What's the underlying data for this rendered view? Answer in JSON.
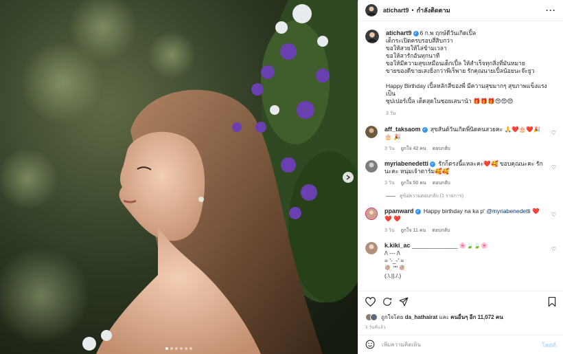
{
  "photo": {
    "carousel_dot_count": 6,
    "carousel_active_index": 0
  },
  "header": {
    "username": "atichart9",
    "separator": "•",
    "follow_state": "กำลังติดตาม"
  },
  "caption": {
    "username": "atichart9",
    "lines": [
      "6 ก.พ ฤกษ์ดีวันเกิดเปิ้ล",
      "เด็กระเปิดครบรอบสี่สิบกว่า",
      "ขอให้สวยให้ไล่ข้ามเวลา",
      "ขอให้สารักอันทุกนาที",
      "ขอให้มีความสุขเหมือนเด็กเปิ้ล ให้สำเร็จทุกสิ่งที่มันหมาย",
      "ขายของดีขายเสงยิ่งกว่าพีเร็พาย รักคุณนายเปิ้ลน้อยนะจ๊ะยูว",
      "",
      "Happy Birthday เปิ้ลหลักสี่ของพี่ มีความสุขมากๆ สุขภาพแข็งแรงเป็น",
      "ซุปเปอร์เปิ้ล เด็ดสุดในซอยเสนาน้า 🎁🎁🎁😍😍😍"
    ],
    "time": "3 วัน"
  },
  "comments": [
    {
      "username": "aff_taksaom",
      "verified": true,
      "text": "สุขสันต์วันเกิดพี่นิดคนสวยคะ 🙏❤️🎂❤️🎉🎂 🎉",
      "time": "3 วัน",
      "likes": "ถูกใจ 42 คน",
      "reply": "ตอบกลับ",
      "avatar_color": "#6b5a3e"
    },
    {
      "username": "myriabenedetti",
      "verified": true,
      "text": "รักก็ตรงนี้แหละคะ❤️🥰 ขอบคุณนะคะ รักนะคะ หนุ่มเจ้าตาร์ม🥰🥰",
      "time": "3 วัน",
      "likes": "ถูกใจ 50 คน",
      "reply": "ตอบกลับ",
      "avatar_color": "#7d7d7d",
      "view_replies": "ดูข้อความตอบกลับ (1 รายการ)"
    },
    {
      "username": "ppanward",
      "verified": true,
      "text_pre": "Happy birthday na ka p'",
      "mention": "@myriabenedetti",
      "text_post": "❤️❤️ ❤️",
      "time": "3 วัน",
      "likes": "ถูกใจ 11 คน",
      "reply": "ตอบกลับ",
      "avatar_color": "#c9a08a"
    },
    {
      "username": "k.kiki_ac",
      "verified": false,
      "text": "______________ 🌸🍃🍃🌸",
      "extra_lines": [
        "/\\ --- /\\",
        "= '-_-' =",
        "🍭 \"\" 🍭",
        "(.\\.||./.)"
      ],
      "avatar_color": "#b08f7b"
    }
  ],
  "likes_bar": {
    "prefix": "ถูกใจโดย",
    "first_user": "da_hathairat",
    "connector": "และ",
    "others": "คนอื่นๆ อีก 11,072 คน"
  },
  "date_text": "3 วันที่แล้ว",
  "add_comment": {
    "placeholder": "เพิ่มความคิดเห็น",
    "post_label": "โพสต์"
  },
  "colors": {
    "verified": "#3897f0",
    "heart_red": "#ed4956",
    "post_disabled": "#b2dffc"
  }
}
